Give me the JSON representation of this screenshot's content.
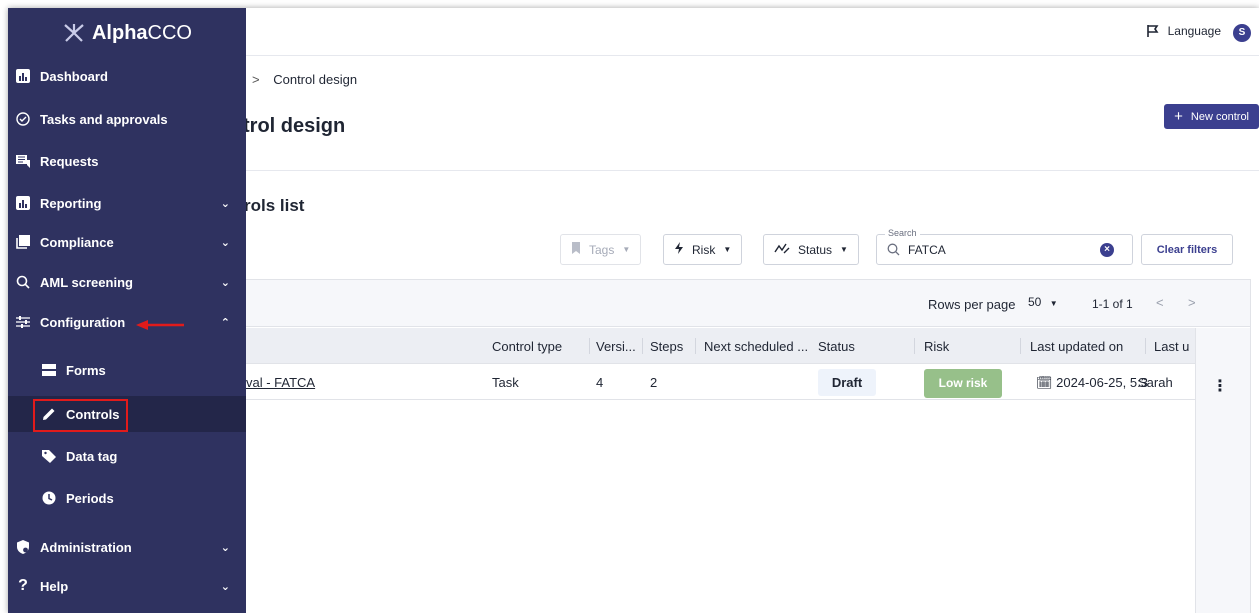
{
  "app": {
    "brand_bold": "Alpha",
    "brand_thin": "CCO"
  },
  "topbar": {
    "language_label": "Language",
    "avatar_initial": "S"
  },
  "breadcrumb": {
    "separator": ">",
    "current": "Control design"
  },
  "page": {
    "title": "trol design",
    "new_button_label": "New control",
    "list_title": "rols list"
  },
  "filters": {
    "tags_label": "Tags",
    "risk_label": "Risk",
    "status_label": "Status",
    "search_label": "Search",
    "search_value": "FATCA",
    "clear_label": "Clear filters"
  },
  "pager": {
    "rows_per_page_label": "Rows per page",
    "rows_per_page_value": "50",
    "count": "1-1 of 1"
  },
  "table": {
    "columns": [
      "Control type",
      "Versi...",
      "Steps",
      "Next scheduled ...",
      "Status",
      "Risk",
      "Last updated on",
      "Last u"
    ],
    "rows": [
      {
        "name": "val - FATCA",
        "control_type": "Task",
        "version": "4",
        "steps": "2",
        "next_scheduled": "",
        "status": "Draft",
        "risk": "Low risk",
        "last_updated_on": "2024-06-25, 5:3",
        "last_updated_by": "Sarah"
      }
    ]
  },
  "sidebar": {
    "items": [
      {
        "label": "Dashboard",
        "icon": "bar-chart-icon"
      },
      {
        "label": "Tasks and approvals",
        "icon": "check-circle-icon"
      },
      {
        "label": "Requests",
        "icon": "chat-icon"
      },
      {
        "label": "Reporting",
        "icon": "bar-chart-icon",
        "expandable": true
      },
      {
        "label": "Compliance",
        "icon": "copy-icon",
        "expandable": true
      },
      {
        "label": "AML screening",
        "icon": "search-icon",
        "expandable": true
      },
      {
        "label": "Configuration",
        "icon": "sliders-icon",
        "expanded": true
      },
      {
        "label": "Administration",
        "icon": "shield-gear-icon",
        "expandable": true
      },
      {
        "label": "Help",
        "icon": "question-icon",
        "expandable": true
      }
    ],
    "sub_items": [
      {
        "label": "Forms",
        "icon": "forms-icon"
      },
      {
        "label": "Controls",
        "icon": "pencil-icon",
        "active": true
      },
      {
        "label": "Data tag",
        "icon": "tag-icon"
      },
      {
        "label": "Periods",
        "icon": "clock-icon"
      }
    ]
  },
  "colors": {
    "sidebar_bg": "#2f3260",
    "accent": "#3b3f8f",
    "low_risk": "#97c08a",
    "annotation_red": "#e11b1b"
  }
}
